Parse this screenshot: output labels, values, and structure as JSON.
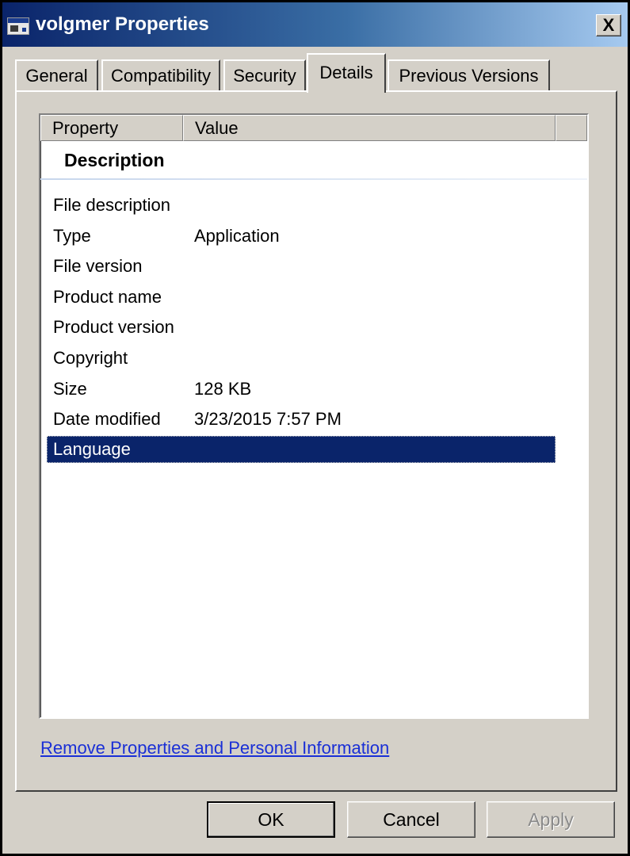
{
  "window": {
    "title": "volgmer Properties",
    "close_label": "X"
  },
  "tabs": [
    {
      "label": "General",
      "active": false
    },
    {
      "label": "Compatibility",
      "active": false
    },
    {
      "label": "Security",
      "active": false
    },
    {
      "label": "Details",
      "active": true
    },
    {
      "label": "Previous Versions",
      "active": false
    }
  ],
  "details": {
    "columns": [
      "Property",
      "Value"
    ],
    "group": "Description",
    "rows": [
      {
        "property": "File description",
        "value": ""
      },
      {
        "property": "Type",
        "value": "Application"
      },
      {
        "property": "File version",
        "value": ""
      },
      {
        "property": "Product name",
        "value": ""
      },
      {
        "property": "Product version",
        "value": ""
      },
      {
        "property": "Copyright",
        "value": ""
      },
      {
        "property": "Size",
        "value": "128 KB"
      },
      {
        "property": "Date modified",
        "value": "3/23/2015 7:57 PM"
      },
      {
        "property": "Language",
        "value": "",
        "selected": true
      }
    ]
  },
  "link_text": "Remove Properties and Personal Information",
  "buttons": {
    "ok": "OK",
    "cancel": "Cancel",
    "apply": "Apply",
    "apply_enabled": false
  },
  "colors": {
    "title_bar_start": "#0a246a",
    "selection": "#0a246a",
    "link": "#1a2fd6",
    "dialog_face": "#d4d0c8"
  }
}
